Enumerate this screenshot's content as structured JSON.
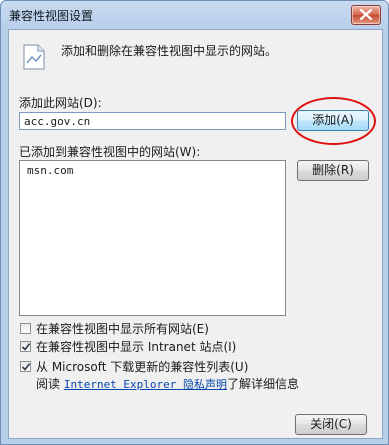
{
  "window": {
    "title": "兼容性视图设置"
  },
  "intro": "添加和删除在兼容性视图中显示的网站。",
  "add_site": {
    "label": "添加此网站(D):",
    "value": "acc.gov.cn",
    "button": "添加(A)"
  },
  "list": {
    "label": "已添加到兼容性视图中的网站(W):",
    "items": [
      "msn.com"
    ],
    "remove_button": "删除(R)"
  },
  "options": [
    {
      "label": "在兼容性视图中显示所有网站(E)",
      "checked": false
    },
    {
      "label": "在兼容性视图中显示 Intranet 站点(I)",
      "checked": true
    },
    {
      "label": "从 Microsoft 下载更新的兼容性列表(U)",
      "checked": true
    }
  ],
  "privacy": {
    "prefix": "阅读 ",
    "link": "Internet Explorer 隐私声明",
    "suffix": "了解详细信息"
  },
  "close_button": "关闭(C)",
  "colors": {
    "annotation": "#e01010",
    "link": "#0645ad"
  }
}
